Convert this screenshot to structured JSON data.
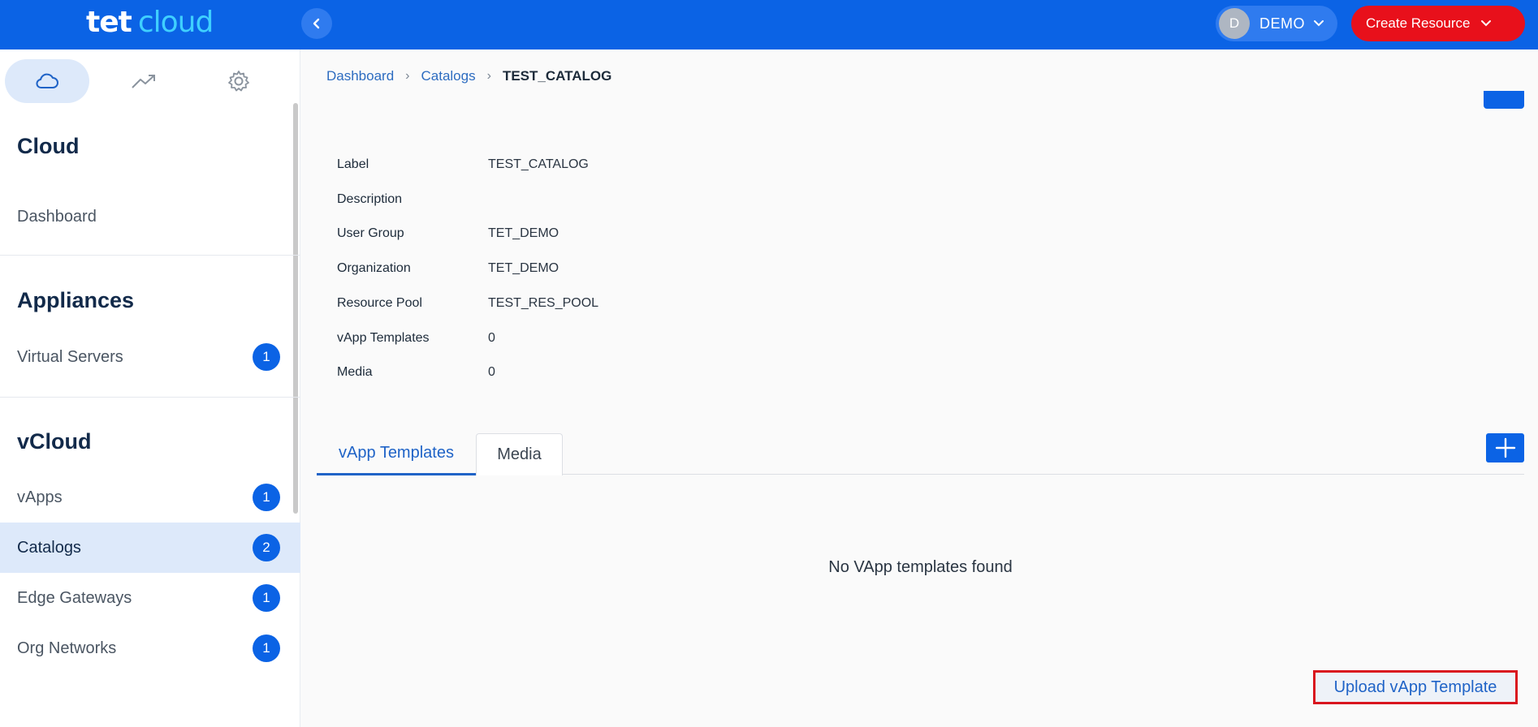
{
  "header": {
    "logo_part1": "tet",
    "logo_part2": "cloud",
    "user_initial": "D",
    "user_name": "DEMO",
    "create_label": "Create Resource"
  },
  "sidebar": {
    "tabs": [
      "cloud-icon",
      "trending-icon",
      "gear-icon"
    ],
    "sections": [
      {
        "title": "Cloud",
        "items": [
          {
            "label": "Dashboard"
          }
        ]
      },
      {
        "title": "Appliances",
        "items": [
          {
            "label": "Virtual Servers",
            "badge": "1"
          }
        ]
      },
      {
        "title": "vCloud",
        "items": [
          {
            "label": "vApps",
            "badge": "1"
          },
          {
            "label": "Catalogs",
            "badge": "2",
            "active": true
          },
          {
            "label": "Edge Gateways",
            "badge": "1"
          },
          {
            "label": "Org Networks",
            "badge": "1"
          }
        ]
      }
    ]
  },
  "breadcrumb": [
    "Dashboard",
    "Catalogs",
    "TEST_CATALOG"
  ],
  "details": [
    {
      "label": "Label",
      "value": "TEST_CATALOG"
    },
    {
      "label": "Description",
      "value": ""
    },
    {
      "label": "User Group",
      "value": "TET_DEMO"
    },
    {
      "label": "Organization",
      "value": "TET_DEMO"
    },
    {
      "label": "Resource Pool",
      "value": "TEST_RES_POOL"
    },
    {
      "label": "vApp Templates",
      "value": "0"
    },
    {
      "label": "Media",
      "value": "0"
    }
  ],
  "tabs": [
    "vApp Templates",
    "Media"
  ],
  "empty_message": "No VApp templates found",
  "upload_label": "Upload vApp Template",
  "colors": {
    "primary": "#0b63e5",
    "danger": "#e8101b",
    "active_bg": "#dde9fa"
  }
}
